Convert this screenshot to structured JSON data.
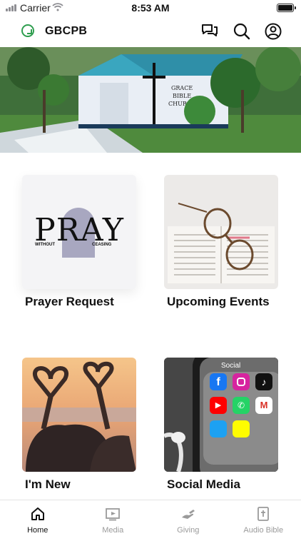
{
  "status_bar": {
    "carrier": "Carrier",
    "time": "8:53 AM"
  },
  "header": {
    "title": "GBCPB",
    "icons": [
      "chat-bubbles-icon",
      "search-icon",
      "profile-icon"
    ]
  },
  "banner": {
    "sign_line1": "GRACE",
    "sign_line2": "BIBLE",
    "sign_line3": "CHURCH"
  },
  "tiles": [
    {
      "label": "Prayer Request",
      "image_word": "PRAY",
      "image_left": "WITHOUT",
      "image_right": "CEASING"
    },
    {
      "label": "Upcoming Events"
    },
    {
      "label": "I'm New"
    },
    {
      "label": "Social Media",
      "image_word": "Social",
      "apps": [
        "Facebook",
        "Instagram",
        "TikTok",
        "YouTube",
        "WhatsApp",
        "Gmail",
        "Twitter",
        "Snapchat"
      ]
    }
  ],
  "tabs": [
    {
      "label": "Home",
      "active": true
    },
    {
      "label": "Media",
      "active": false
    },
    {
      "label": "Giving",
      "active": false
    },
    {
      "label": "Audio Bible",
      "active": false
    }
  ],
  "colors": {
    "accent": "#2f9e4f",
    "inactive": "#9a9a9a"
  }
}
